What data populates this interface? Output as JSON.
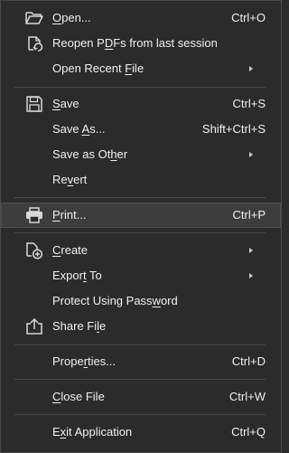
{
  "menu": {
    "items": [
      {
        "key": "open",
        "pre": "",
        "u": "O",
        "post": "pen...",
        "shortcut": "Ctrl+O",
        "icon": "folder-open-icon"
      },
      {
        "key": "reopen",
        "pre": "Reopen P",
        "u": "D",
        "post": "Fs from last session",
        "shortcut": "",
        "icon": "reopen-document-icon"
      },
      {
        "key": "open_recent",
        "pre": "Open Recent ",
        "u": "F",
        "post": "ile",
        "shortcut": "",
        "icon": ""
      },
      {
        "key": "save",
        "pre": "",
        "u": "S",
        "post": "ave",
        "shortcut": "Ctrl+S",
        "icon": "save-icon"
      },
      {
        "key": "save_as",
        "pre": "Save ",
        "u": "A",
        "post": "s...",
        "shortcut": "Shift+Ctrl+S",
        "icon": ""
      },
      {
        "key": "save_as_other",
        "pre": "Save as Ot",
        "u": "h",
        "post": "er",
        "shortcut": "",
        "icon": ""
      },
      {
        "key": "revert",
        "pre": "Re",
        "u": "v",
        "post": "ert",
        "shortcut": "",
        "icon": ""
      },
      {
        "key": "print",
        "pre": "",
        "u": "P",
        "post": "rint...",
        "shortcut": "Ctrl+P",
        "icon": "printer-icon"
      },
      {
        "key": "create",
        "pre": "",
        "u": "C",
        "post": "reate",
        "shortcut": "",
        "icon": "create-document-icon"
      },
      {
        "key": "export_to",
        "pre": "Expor",
        "u": "t",
        "post": " To",
        "shortcut": "",
        "icon": ""
      },
      {
        "key": "protect",
        "pre": "Protect Using Pass",
        "u": "w",
        "post": "ord",
        "shortcut": "",
        "icon": ""
      },
      {
        "key": "share",
        "pre": "Share Fi",
        "u": "l",
        "post": "e",
        "shortcut": "",
        "icon": "share-icon"
      },
      {
        "key": "properties",
        "pre": "Prope",
        "u": "r",
        "post": "ties...",
        "shortcut": "Ctrl+D",
        "icon": ""
      },
      {
        "key": "close",
        "pre": "",
        "u": "C",
        "post": "lose File",
        "shortcut": "Ctrl+W",
        "icon": ""
      },
      {
        "key": "exit",
        "pre": "E",
        "u": "x",
        "post": "it Application",
        "shortcut": "Ctrl+Q",
        "icon": ""
      }
    ]
  }
}
